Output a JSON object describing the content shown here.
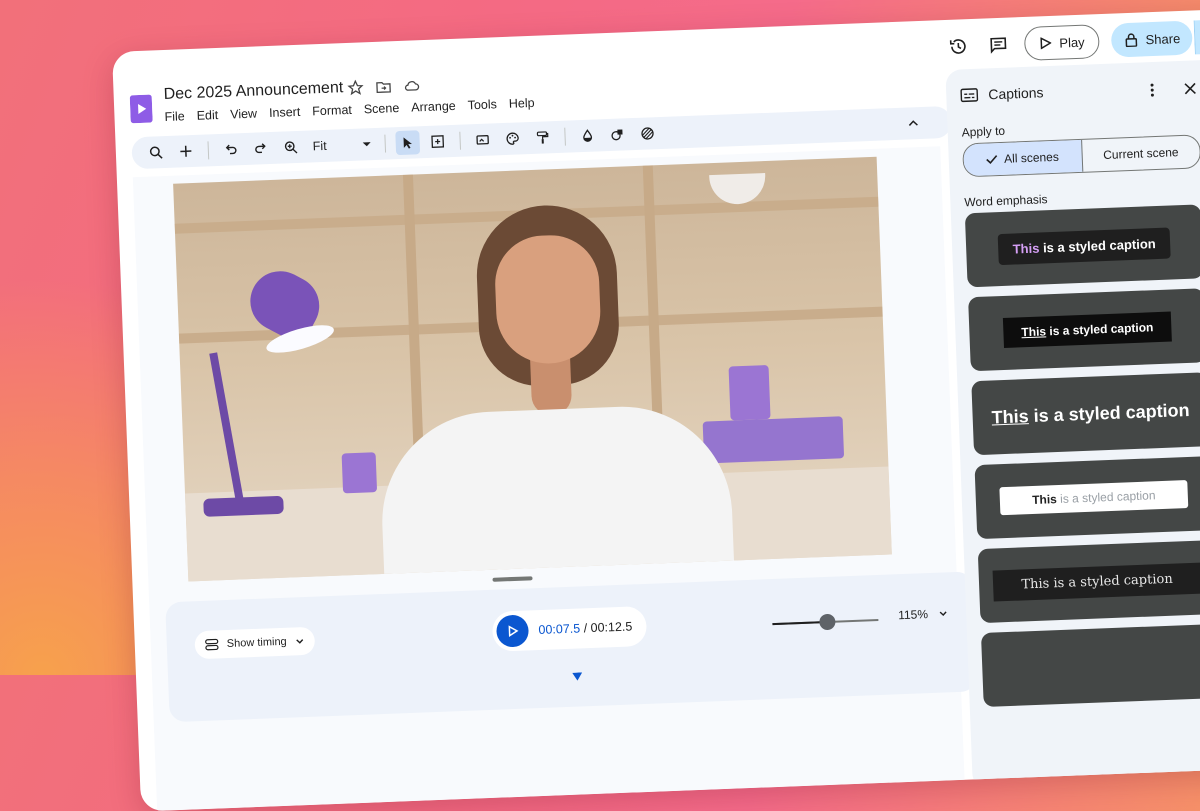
{
  "document": {
    "title": "Dec 2025 Announcement"
  },
  "menu": [
    "File",
    "Edit",
    "View",
    "Insert",
    "Format",
    "Scene",
    "Arrange",
    "Tools",
    "Help"
  ],
  "header": {
    "play_label": "Play",
    "share_label": "Share"
  },
  "toolbar": {
    "zoom_fit": "Fit"
  },
  "timeline": {
    "show_timing_label": "Show timing",
    "current_time": "00:07.5",
    "separator": " / ",
    "total_time": "00:12.5",
    "zoom_percent": "115%",
    "zoom_level": 0.52
  },
  "panel": {
    "title": "Captions",
    "apply_to_label": "Apply to",
    "apply_options": [
      "All scenes",
      "Current scene"
    ],
    "selected_option": "All scenes",
    "word_emphasis_label": "Word emphasis",
    "styles": [
      {
        "emphasis": "This",
        "rest": " is a styled caption"
      },
      {
        "emphasis": "This",
        "rest": " is a styled caption"
      },
      {
        "emphasis": "This",
        "rest": " is a styled caption"
      },
      {
        "emphasis": "This",
        "rest": " is a styled caption"
      },
      {
        "emphasis": "",
        "rest": "This is a styled caption"
      }
    ]
  },
  "colors": {
    "accent_blue": "#0b57d0",
    "share_bg": "#c2e7ff",
    "emphasis_purple": "#d59ff5"
  }
}
